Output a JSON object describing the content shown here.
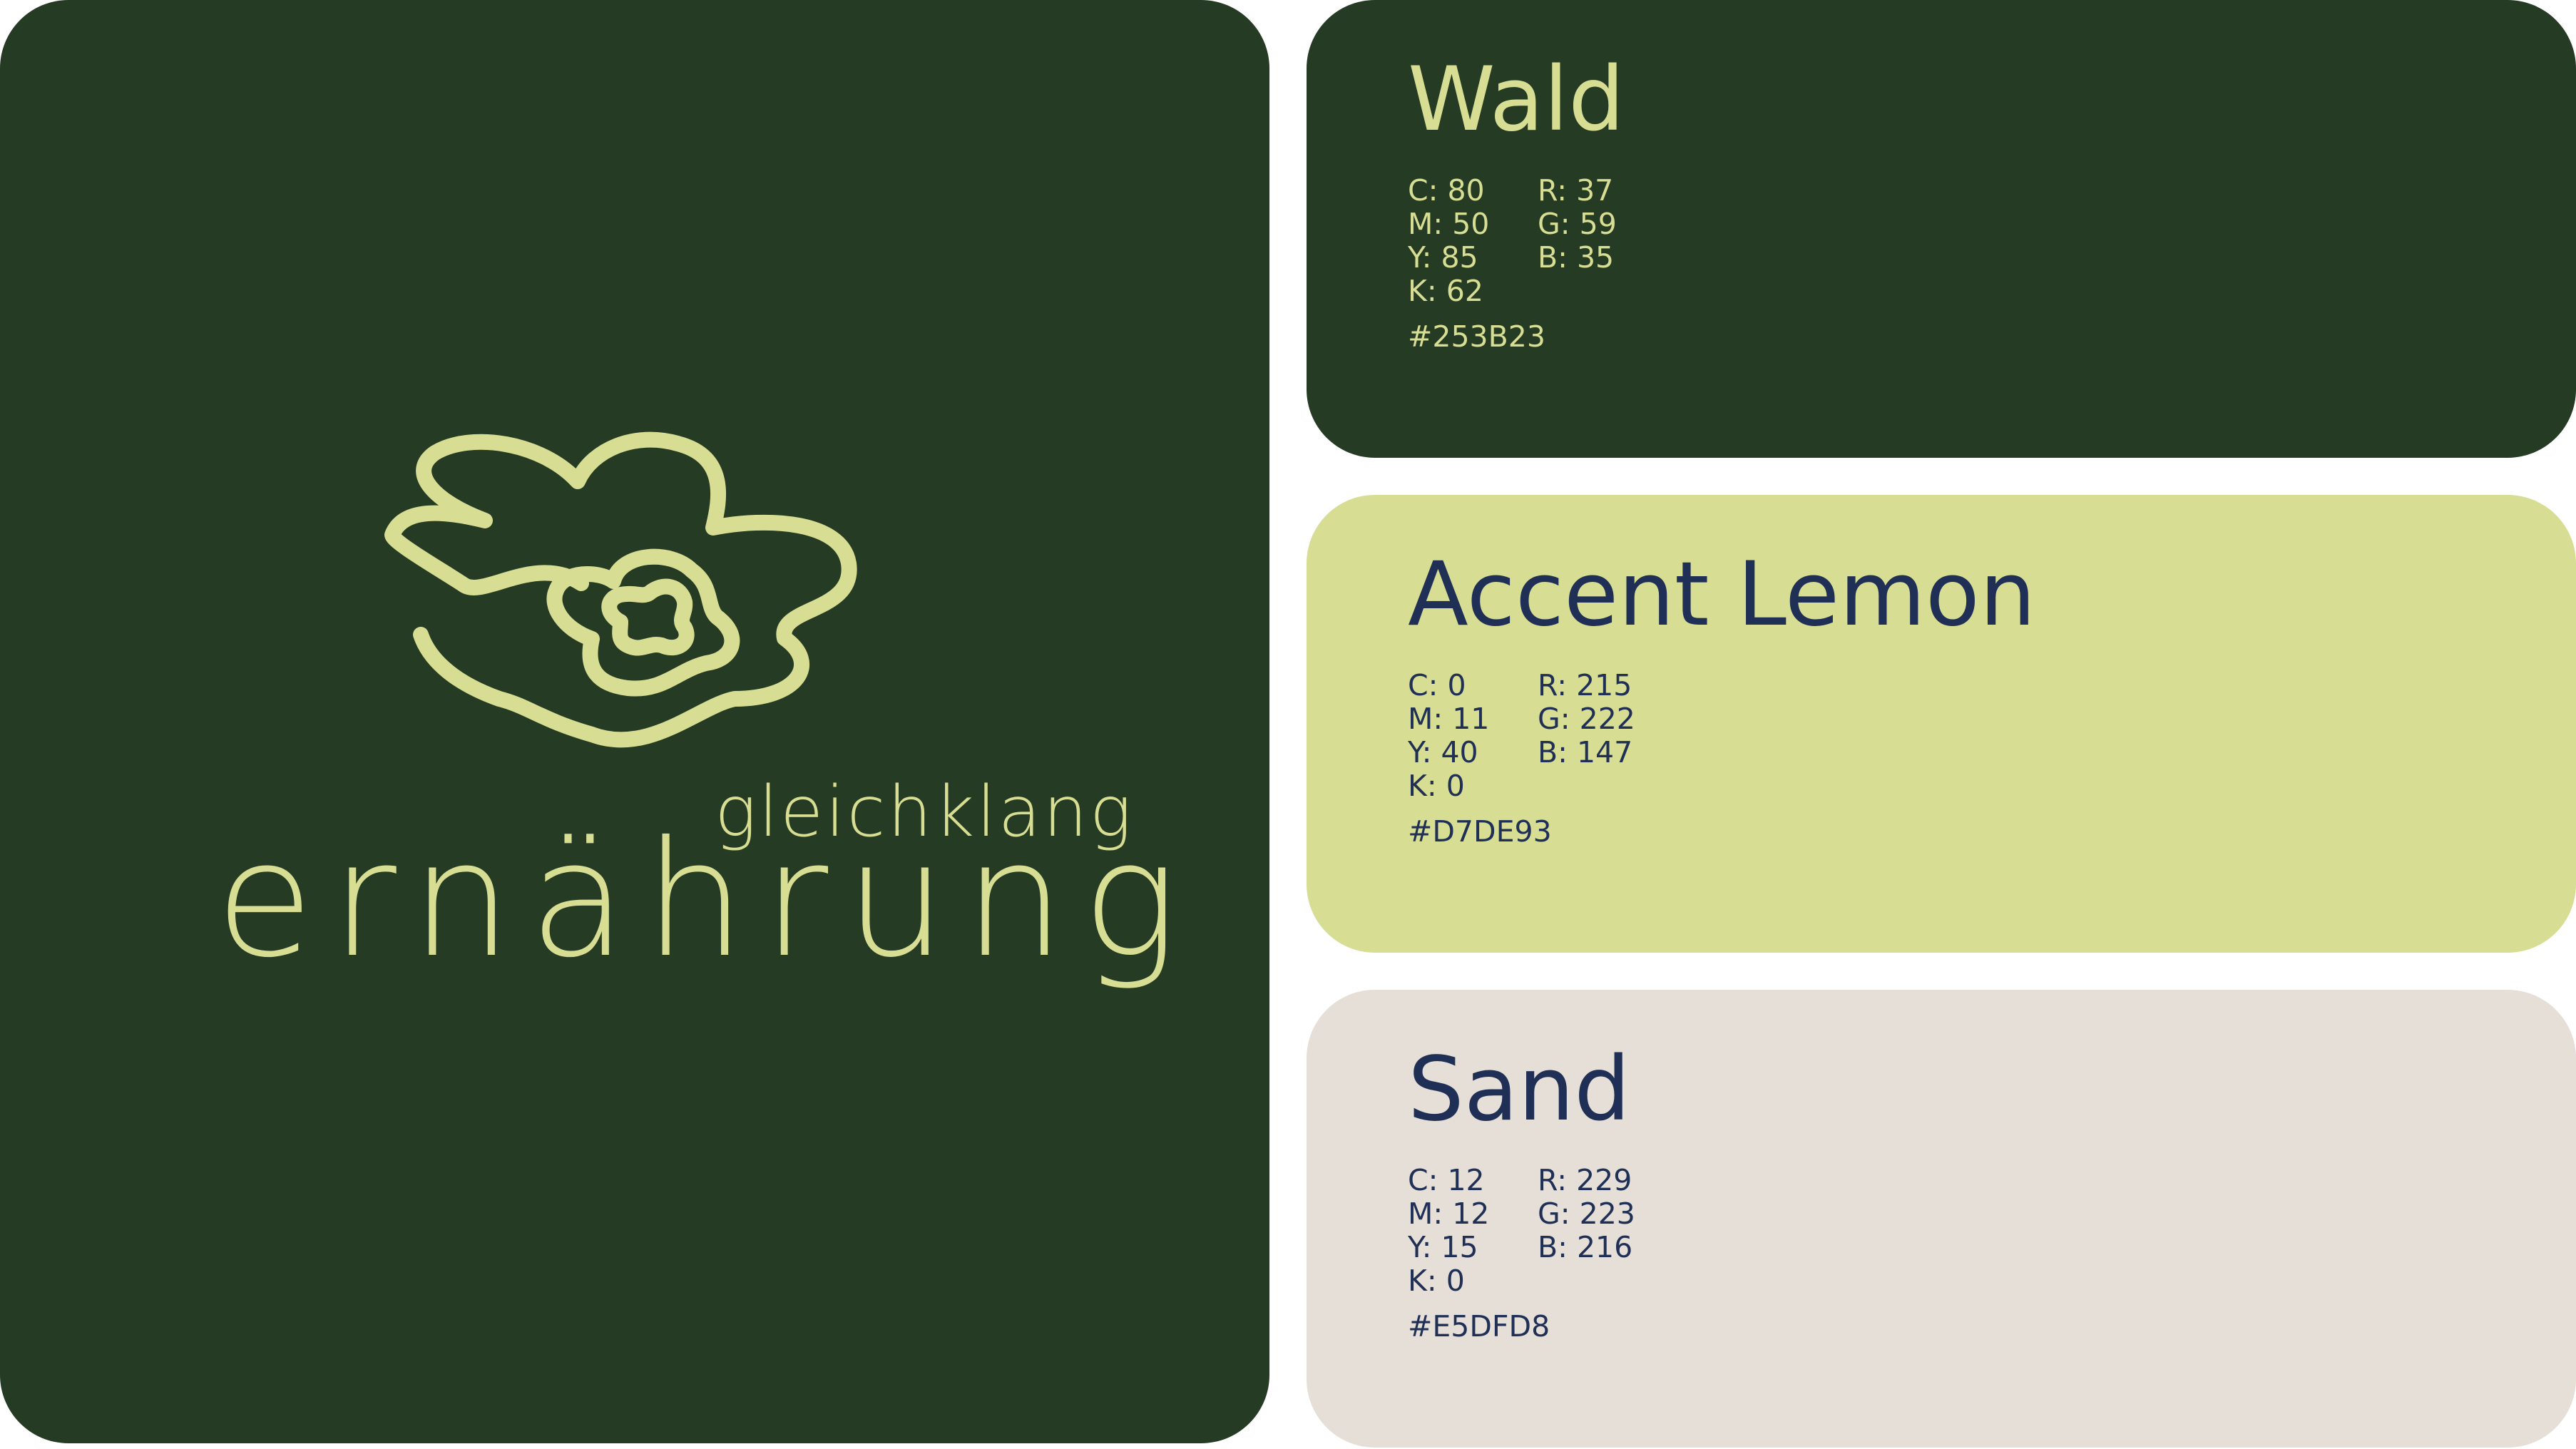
{
  "logo": {
    "brand_line1": "gleichklang",
    "brand_line2": "ernährung",
    "icon": "flower-outline-icon",
    "color": "#D7DE93",
    "background": "#253B23"
  },
  "swatches": [
    {
      "name": "Wald",
      "c": "C: 80",
      "m": "M: 50",
      "y": "Y: 85",
      "k": "K: 62",
      "r": "R: 37",
      "g": "G: 59",
      "b": "B: 35",
      "hex": "#253B23",
      "background": "#253B23",
      "text_color": "#D7DE93"
    },
    {
      "name": "Accent Lemon",
      "c": "C: 0",
      "m": "M: 11",
      "y": "Y: 40",
      "k": "K: 0",
      "r": "R: 215",
      "g": "G: 222",
      "b": "B: 147",
      "hex": "#D7DE93",
      "background": "#D7DE93",
      "text_color": "#1F2F55"
    },
    {
      "name": "Sand",
      "c": "C: 12",
      "m": "M: 12",
      "y": "Y: 15",
      "k": "K: 0",
      "r": "R: 229",
      "g": "G: 223",
      "b": "B: 216",
      "hex": "#E5DFD8",
      "background": "#E5DFD8",
      "text_color": "#1F2F55"
    }
  ]
}
